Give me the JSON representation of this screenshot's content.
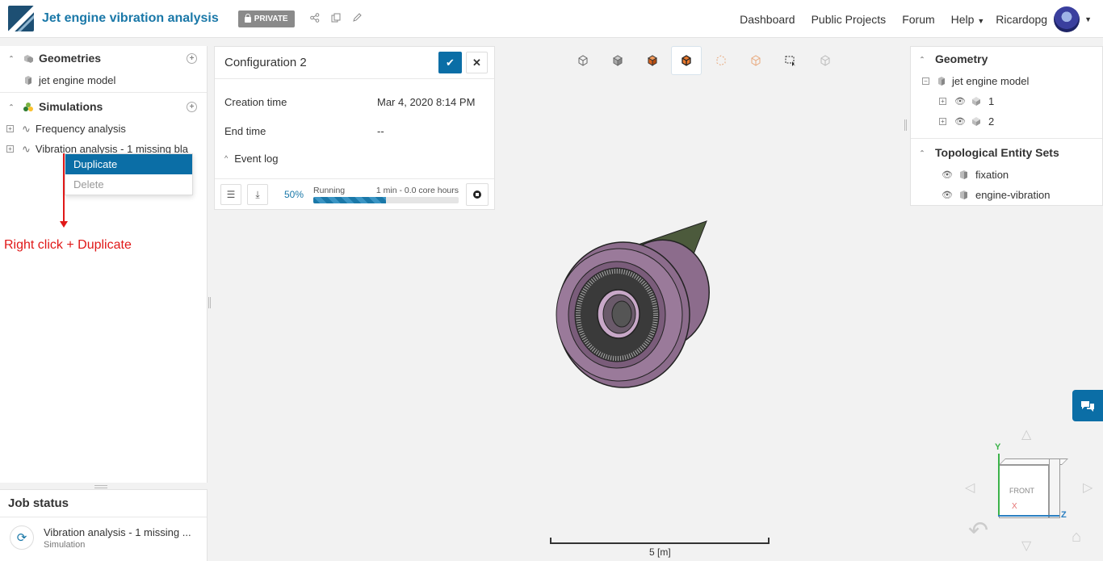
{
  "header": {
    "project_title": "Jet engine vibration analysis",
    "private_label": "PRIVATE",
    "nav": [
      "Dashboard",
      "Public Projects",
      "Forum",
      "Help",
      "Ricardopg"
    ]
  },
  "left_panel": {
    "geometries_label": "Geometries",
    "geometry_item": "jet engine model",
    "simulations_label": "Simulations",
    "sim_items": [
      "Frequency analysis",
      "Vibration analysis - 1 missing bla..."
    ]
  },
  "context_menu": {
    "items": [
      "Duplicate",
      "Delete"
    ]
  },
  "annotation": {
    "text": "Right click + Duplicate",
    "color": "#e01818"
  },
  "job_status": {
    "title": "Job status",
    "job_name": "Vibration analysis - 1 missing ...",
    "job_type": "Simulation"
  },
  "config": {
    "title": "Configuration 2",
    "creation_label": "Creation time",
    "creation_value": "Mar 4, 2020 8:14 PM",
    "end_label": "End time",
    "end_value": "--",
    "event_log": "Event log",
    "progress_pct": "50%",
    "progress_fraction": 0.5,
    "status": "Running",
    "core_hours": "1 min - 0.0 core hours"
  },
  "right_panel": {
    "geometry_label": "Geometry",
    "model_name": "jet engine model",
    "parts": [
      "1",
      "2"
    ],
    "topo_label": "Topological Entity Sets",
    "topo_items": [
      "fixation",
      "engine-vibration"
    ]
  },
  "viewport": {
    "scale_label": "5 [m]",
    "viewcube_face": "FRONT",
    "axis_y": "Y",
    "axis_z": "Z",
    "axis_x": "X"
  },
  "colors": {
    "brand": "#1a78a8",
    "accent": "#0b6ea6",
    "engine": "#8c6c8c",
    "pylon": "#4c5a3c"
  }
}
